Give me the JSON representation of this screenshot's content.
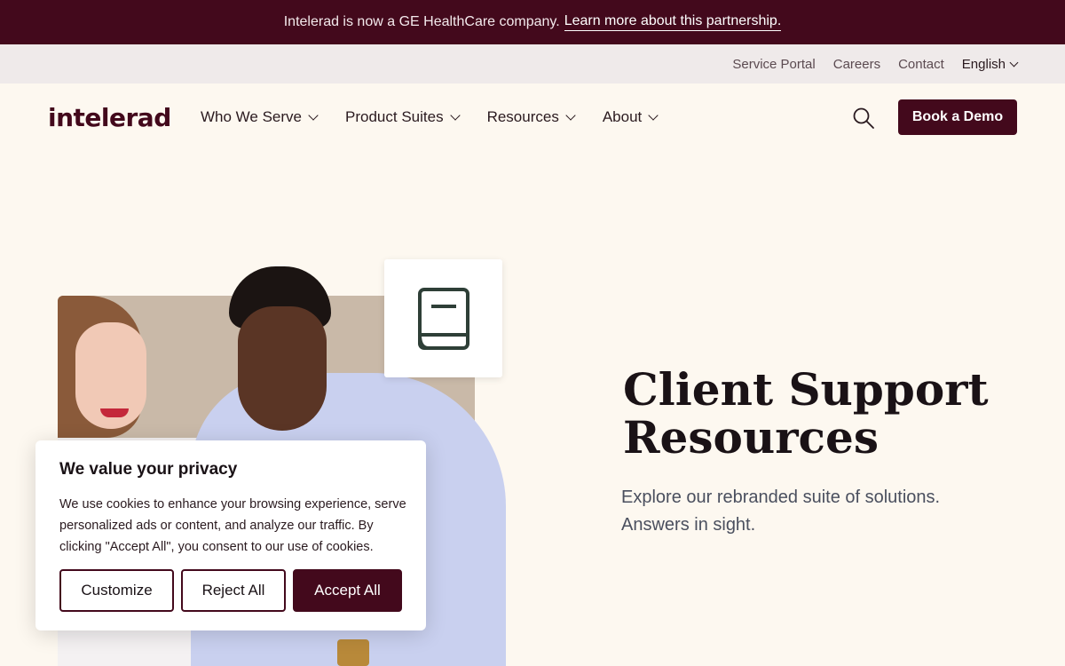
{
  "announcement": {
    "text": "Intelerad is now a GE HealthCare company.",
    "link_label": "Learn more about this partnership."
  },
  "utility_nav": {
    "items": [
      "Service Portal",
      "Careers",
      "Contact"
    ],
    "language": "English"
  },
  "header": {
    "logo": "intelerad",
    "nav": [
      "Who We Serve",
      "Product Suites",
      "Resources",
      "About"
    ],
    "search_icon": "search-icon",
    "cta_label": "Book a Demo"
  },
  "hero": {
    "title_line1": "Client Support",
    "title_line2": "Resources",
    "subtitle_line1": "Explore our rebranded suite of solutions.",
    "subtitle_line2": "Answers in sight.",
    "card_icon": "book-icon"
  },
  "cookie_banner": {
    "title": "We value your privacy",
    "text": "We use cookies to enhance your browsing experience, serve personalized ads or content, and analyze our traffic. By clicking \"Accept All\", you consent to our use of cookies.",
    "customize_label": "Customize",
    "reject_label": "Reject All",
    "accept_label": "Accept All"
  },
  "colors": {
    "brand": "#43091c",
    "page_bg": "#fdf8f0",
    "utility_bg": "#efeaea",
    "icon_green": "#2e3f37"
  }
}
